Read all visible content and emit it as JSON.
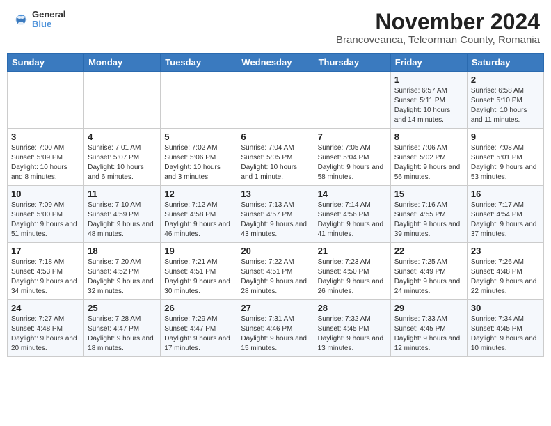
{
  "header": {
    "logo_line1": "General",
    "logo_line2": "Blue",
    "title": "November 2024",
    "subtitle": "Brancoveanca, Teleorman County, Romania"
  },
  "days_of_week": [
    "Sunday",
    "Monday",
    "Tuesday",
    "Wednesday",
    "Thursday",
    "Friday",
    "Saturday"
  ],
  "weeks": [
    [
      {
        "day": "",
        "info": ""
      },
      {
        "day": "",
        "info": ""
      },
      {
        "day": "",
        "info": ""
      },
      {
        "day": "",
        "info": ""
      },
      {
        "day": "",
        "info": ""
      },
      {
        "day": "1",
        "info": "Sunrise: 6:57 AM\nSunset: 5:11 PM\nDaylight: 10 hours and 14 minutes."
      },
      {
        "day": "2",
        "info": "Sunrise: 6:58 AM\nSunset: 5:10 PM\nDaylight: 10 hours and 11 minutes."
      }
    ],
    [
      {
        "day": "3",
        "info": "Sunrise: 7:00 AM\nSunset: 5:09 PM\nDaylight: 10 hours and 8 minutes."
      },
      {
        "day": "4",
        "info": "Sunrise: 7:01 AM\nSunset: 5:07 PM\nDaylight: 10 hours and 6 minutes."
      },
      {
        "day": "5",
        "info": "Sunrise: 7:02 AM\nSunset: 5:06 PM\nDaylight: 10 hours and 3 minutes."
      },
      {
        "day": "6",
        "info": "Sunrise: 7:04 AM\nSunset: 5:05 PM\nDaylight: 10 hours and 1 minute."
      },
      {
        "day": "7",
        "info": "Sunrise: 7:05 AM\nSunset: 5:04 PM\nDaylight: 9 hours and 58 minutes."
      },
      {
        "day": "8",
        "info": "Sunrise: 7:06 AM\nSunset: 5:02 PM\nDaylight: 9 hours and 56 minutes."
      },
      {
        "day": "9",
        "info": "Sunrise: 7:08 AM\nSunset: 5:01 PM\nDaylight: 9 hours and 53 minutes."
      }
    ],
    [
      {
        "day": "10",
        "info": "Sunrise: 7:09 AM\nSunset: 5:00 PM\nDaylight: 9 hours and 51 minutes."
      },
      {
        "day": "11",
        "info": "Sunrise: 7:10 AM\nSunset: 4:59 PM\nDaylight: 9 hours and 48 minutes."
      },
      {
        "day": "12",
        "info": "Sunrise: 7:12 AM\nSunset: 4:58 PM\nDaylight: 9 hours and 46 minutes."
      },
      {
        "day": "13",
        "info": "Sunrise: 7:13 AM\nSunset: 4:57 PM\nDaylight: 9 hours and 43 minutes."
      },
      {
        "day": "14",
        "info": "Sunrise: 7:14 AM\nSunset: 4:56 PM\nDaylight: 9 hours and 41 minutes."
      },
      {
        "day": "15",
        "info": "Sunrise: 7:16 AM\nSunset: 4:55 PM\nDaylight: 9 hours and 39 minutes."
      },
      {
        "day": "16",
        "info": "Sunrise: 7:17 AM\nSunset: 4:54 PM\nDaylight: 9 hours and 37 minutes."
      }
    ],
    [
      {
        "day": "17",
        "info": "Sunrise: 7:18 AM\nSunset: 4:53 PM\nDaylight: 9 hours and 34 minutes."
      },
      {
        "day": "18",
        "info": "Sunrise: 7:20 AM\nSunset: 4:52 PM\nDaylight: 9 hours and 32 minutes."
      },
      {
        "day": "19",
        "info": "Sunrise: 7:21 AM\nSunset: 4:51 PM\nDaylight: 9 hours and 30 minutes."
      },
      {
        "day": "20",
        "info": "Sunrise: 7:22 AM\nSunset: 4:51 PM\nDaylight: 9 hours and 28 minutes."
      },
      {
        "day": "21",
        "info": "Sunrise: 7:23 AM\nSunset: 4:50 PM\nDaylight: 9 hours and 26 minutes."
      },
      {
        "day": "22",
        "info": "Sunrise: 7:25 AM\nSunset: 4:49 PM\nDaylight: 9 hours and 24 minutes."
      },
      {
        "day": "23",
        "info": "Sunrise: 7:26 AM\nSunset: 4:48 PM\nDaylight: 9 hours and 22 minutes."
      }
    ],
    [
      {
        "day": "24",
        "info": "Sunrise: 7:27 AM\nSunset: 4:48 PM\nDaylight: 9 hours and 20 minutes."
      },
      {
        "day": "25",
        "info": "Sunrise: 7:28 AM\nSunset: 4:47 PM\nDaylight: 9 hours and 18 minutes."
      },
      {
        "day": "26",
        "info": "Sunrise: 7:29 AM\nSunset: 4:47 PM\nDaylight: 9 hours and 17 minutes."
      },
      {
        "day": "27",
        "info": "Sunrise: 7:31 AM\nSunset: 4:46 PM\nDaylight: 9 hours and 15 minutes."
      },
      {
        "day": "28",
        "info": "Sunrise: 7:32 AM\nSunset: 4:45 PM\nDaylight: 9 hours and 13 minutes."
      },
      {
        "day": "29",
        "info": "Sunrise: 7:33 AM\nSunset: 4:45 PM\nDaylight: 9 hours and 12 minutes."
      },
      {
        "day": "30",
        "info": "Sunrise: 7:34 AM\nSunset: 4:45 PM\nDaylight: 9 hours and 10 minutes."
      }
    ]
  ]
}
